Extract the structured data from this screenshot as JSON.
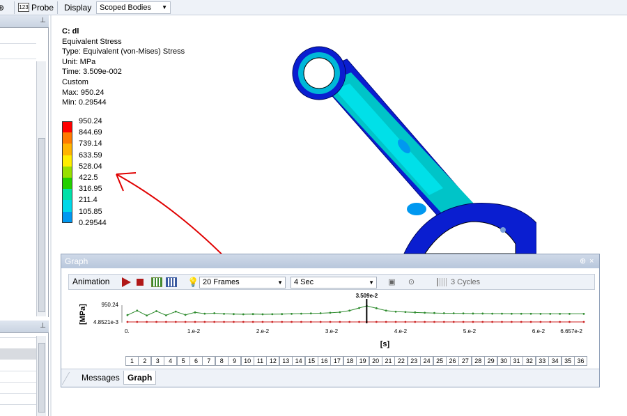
{
  "toolbar": {
    "probe_label": "Probe",
    "probe_icon_text": "123",
    "display_label": "Display",
    "scope_select_value": "Scoped Bodies"
  },
  "result_info": {
    "title": "C: dl",
    "line1": "Equivalent Stress",
    "line2": "Type: Equivalent (von-Mises) Stress",
    "line3": "Unit: MPa",
    "line4": "Time: 3.509e-002",
    "line5": "Custom",
    "line6": "Max: 950.24",
    "line7": "Min: 0.29544"
  },
  "legend": {
    "labels": [
      "950.24",
      "844.69",
      "739.14",
      "633.59",
      "528.04",
      "422.5",
      "316.95",
      "211.4",
      "105.85",
      "0.29544"
    ],
    "colors": [
      "#ff0000",
      "#ff7a00",
      "#ffb400",
      "#ffee00",
      "#98e000",
      "#22d000",
      "#00e0a8",
      "#00d8e8",
      "#0098f0",
      "#0010f0"
    ]
  },
  "graph_window": {
    "title": "Graph",
    "pin_glyph": "⊕",
    "close_glyph": "×",
    "animation_label": "Animation",
    "frames_value": "20 Frames",
    "duration_value": "4 Sec",
    "cycles_label": "3 Cycles",
    "tabs": [
      "Messages",
      "Graph"
    ],
    "frame_numbers": [
      "1",
      "2",
      "3",
      "4",
      "5",
      "6",
      "7",
      "8",
      "9",
      "10",
      "11",
      "12",
      "13",
      "14",
      "15",
      "16",
      "17",
      "18",
      "19",
      "20",
      "21",
      "22",
      "23",
      "24",
      "25",
      "26",
      "27",
      "28",
      "29",
      "30",
      "31",
      "32",
      "33",
      "34",
      "35",
      "36"
    ]
  },
  "chart_data": {
    "type": "line",
    "ylabel": "[MPa]",
    "xlabel": "[s]",
    "x_tick_labels": [
      "0.",
      "1.e-2",
      "2.e-2",
      "3.e-2",
      "4.e-2",
      "5.e-2",
      "6.e-2",
      "6.657e-2"
    ],
    "x_ticks": [
      0,
      0.01,
      0.02,
      0.03,
      0.04,
      0.05,
      0.06,
      0.06657
    ],
    "y_tick_labels": [
      "950.24",
      "4.8521e-3"
    ],
    "xlim": [
      0,
      0.06657
    ],
    "ylim": [
      0.0048521,
      950.24
    ],
    "current_time_label": "3.509e-2",
    "current_time": 0.03509,
    "series": [
      {
        "role": "max",
        "color": "#2e8b2e",
        "x": [
          0.0004,
          0.0018,
          0.0032,
          0.0046,
          0.006,
          0.0074,
          0.0088,
          0.0102,
          0.0116,
          0.013,
          0.0144,
          0.0158,
          0.0172,
          0.0186,
          0.02,
          0.0214,
          0.0228,
          0.0242,
          0.0256,
          0.027,
          0.0284,
          0.0298,
          0.0312,
          0.0326,
          0.034,
          0.03509,
          0.0365,
          0.0379,
          0.0393,
          0.0407,
          0.0421,
          0.0435,
          0.0449,
          0.0463,
          0.0477,
          0.0491,
          0.0505,
          0.0519,
          0.0533,
          0.0547,
          0.0561,
          0.0575,
          0.0589,
          0.0603,
          0.0617,
          0.0631,
          0.0645,
          0.06657
        ],
        "y": [
          862,
          905,
          858,
          900,
          860,
          896,
          864,
          888,
          876,
          880,
          874,
          872,
          870,
          872,
          870,
          871,
          872,
          874,
          876,
          878,
          880,
          884,
          890,
          905,
          930,
          950.24,
          928,
          905,
          895,
          892,
          888,
          884,
          882,
          880,
          879,
          878,
          877,
          877,
          876,
          876,
          875,
          875,
          875,
          874,
          874,
          874,
          874,
          874
        ]
      },
      {
        "role": "min",
        "color": "#cc2222",
        "x": [
          0.0004,
          0.0018,
          0.0032,
          0.0046,
          0.006,
          0.0074,
          0.0088,
          0.0102,
          0.0116,
          0.013,
          0.0144,
          0.0158,
          0.0172,
          0.0186,
          0.02,
          0.0214,
          0.0228,
          0.0242,
          0.0256,
          0.027,
          0.0284,
          0.0298,
          0.0312,
          0.0326,
          0.034,
          0.03509,
          0.0365,
          0.0379,
          0.0393,
          0.0407,
          0.0421,
          0.0435,
          0.0449,
          0.0463,
          0.0477,
          0.0491,
          0.0505,
          0.0519,
          0.0533,
          0.0547,
          0.0561,
          0.0575,
          0.0589,
          0.0603,
          0.0617,
          0.0631,
          0.0645,
          0.06657
        ],
        "y": [
          0.005,
          0.005,
          0.005,
          0.005,
          0.005,
          0.005,
          0.005,
          0.005,
          0.005,
          0.005,
          0.005,
          0.005,
          0.005,
          0.005,
          0.005,
          0.005,
          0.005,
          0.005,
          0.005,
          0.005,
          0.005,
          0.005,
          0.005,
          0.005,
          0.005,
          0.005,
          0.005,
          0.005,
          0.005,
          0.005,
          0.005,
          0.005,
          0.005,
          0.005,
          0.005,
          0.005,
          0.005,
          0.005,
          0.005,
          0.005,
          0.005,
          0.005,
          0.005,
          0.005,
          0.005,
          0.005,
          0.005,
          0.005
        ]
      }
    ]
  }
}
